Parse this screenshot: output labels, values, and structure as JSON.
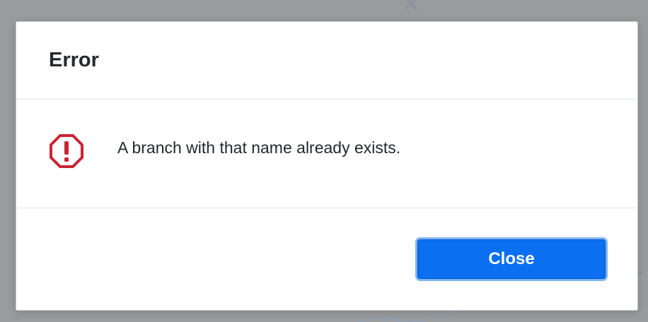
{
  "dialog": {
    "title": "Error",
    "message": "A branch with that name already exists.",
    "close_label": "Close",
    "icon": "error-octagon-icon"
  },
  "colors": {
    "error_icon": "#cb2431",
    "primary_button": "#0a6ff0",
    "overlay": "#9a9b9d"
  }
}
